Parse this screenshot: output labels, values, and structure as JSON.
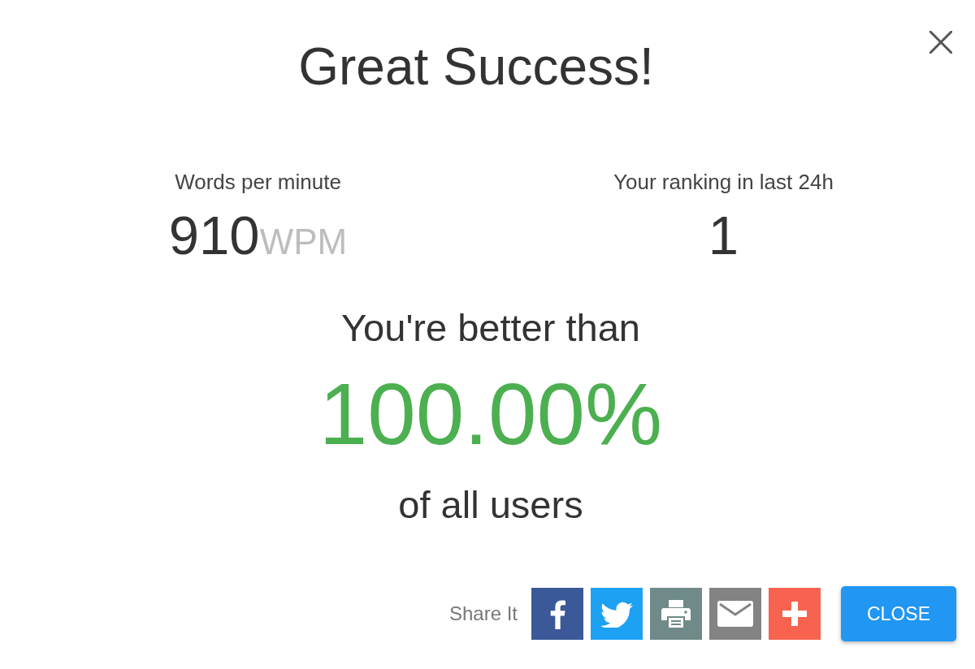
{
  "dialog": {
    "title": "Great Success!"
  },
  "stats": [
    {
      "label": "Words per minute",
      "value": "910",
      "unit": "WPM"
    },
    {
      "label": "Your ranking in last 24h",
      "value": "1"
    }
  ],
  "comparison": {
    "lead": "You're better than",
    "percentage": "100.00%",
    "tail": "of all users"
  },
  "share": {
    "label": "Share It",
    "services": [
      {
        "kind": "facebook",
        "color": "#3b5998"
      },
      {
        "kind": "twitter",
        "color": "#1da1f2"
      },
      {
        "kind": "print",
        "color": "#6f8a88"
      },
      {
        "kind": "email",
        "color": "#838383"
      },
      {
        "kind": "more",
        "color": "#f7634f"
      }
    ]
  },
  "buttons": [
    {
      "label": "CLOSE"
    }
  ]
}
